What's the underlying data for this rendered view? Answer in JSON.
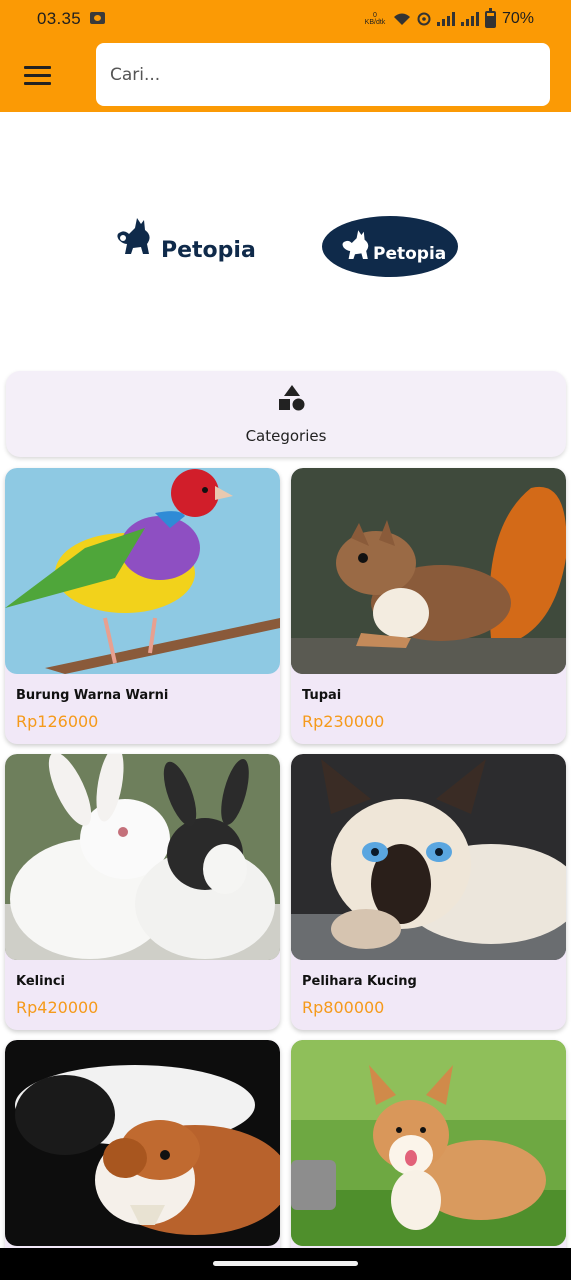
{
  "status_bar": {
    "time": "03.35",
    "network_speed": "0\nKB/dtk",
    "battery": "70%"
  },
  "header": {
    "search_placeholder": "Cari...",
    "menu_icon": "hamburger-menu-icon"
  },
  "logos": {
    "logo_text": "Petopia"
  },
  "categories": {
    "label": "Categories",
    "icon": "shapes-icon"
  },
  "products": [
    {
      "name": "Burung Warna Warni",
      "price": "Rp126000",
      "image": "bird"
    },
    {
      "name": "Tupai",
      "price": "Rp230000",
      "image": "squirrel"
    },
    {
      "name": "Kelinci",
      "price": "Rp420000",
      "image": "rabbits"
    },
    {
      "name": "Pelihara Kucing",
      "price": "Rp800000",
      "image": "cat"
    },
    {
      "name": "",
      "price": "",
      "image": "guinea-pigs"
    },
    {
      "name": "",
      "price": "",
      "image": "corgi"
    }
  ],
  "colors": {
    "header_bg": "#fb9a05",
    "card_bg": "#f1e8f7",
    "price": "#f59a1b",
    "logo_navy": "#0f2a4a"
  }
}
